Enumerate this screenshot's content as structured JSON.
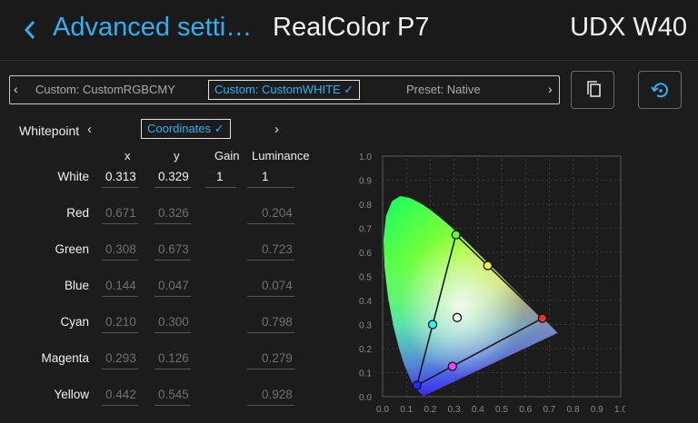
{
  "header": {
    "back_icon": "chevron-left-icon",
    "title_section": "Advanced setti…",
    "title_profile": "RealColor P7",
    "title_device": "UDX W40"
  },
  "profile_selector": {
    "prev_arrow": "‹",
    "next_arrow": "›",
    "left_item": "Custom: CustomRGBCMY",
    "active_item": "Custom: CustomWHITE ✓",
    "right_item": "Preset: Native"
  },
  "toolbar": {
    "copy_icon": "copy-icon",
    "reset_icon": "reset-icon"
  },
  "whitepoint": {
    "label": "Whitepoint",
    "prev_arrow": "‹",
    "next_arrow": "›",
    "active_item": "Coordinates ✓"
  },
  "table": {
    "columns": [
      "x",
      "y",
      "Gain",
      "Luminance"
    ],
    "rows": [
      {
        "name": "White",
        "x": "0.313",
        "y": "0.329",
        "gain": "1",
        "lum": "1"
      },
      {
        "name": "Red",
        "x": "0.671",
        "y": "0.326",
        "gain": "",
        "lum": "0.204"
      },
      {
        "name": "Green",
        "x": "0.308",
        "y": "0.673",
        "gain": "",
        "lum": "0.723"
      },
      {
        "name": "Blue",
        "x": "0.144",
        "y": "0.047",
        "gain": "",
        "lum": "0.074"
      },
      {
        "name": "Cyan",
        "x": "0.210",
        "y": "0.300",
        "gain": "",
        "lum": "0.798"
      },
      {
        "name": "Magenta",
        "x": "0.293",
        "y": "0.126",
        "gain": "",
        "lum": "0.279"
      },
      {
        "name": "Yellow",
        "x": "0.442",
        "y": "0.545",
        "gain": "",
        "lum": "0.928"
      }
    ]
  },
  "colors": {
    "accent": "#2fb0f2",
    "background": "#1c1c1c"
  },
  "chart_data": {
    "type": "scatter",
    "x_ticks": [
      "0.0",
      "0.1",
      "0.2",
      "0.3",
      "0.4",
      "0.5",
      "0.6",
      "0.7",
      "0.8",
      "0.9",
      "1.0"
    ],
    "y_ticks": [
      "0.0",
      "0.1",
      "0.2",
      "0.3",
      "0.4",
      "0.5",
      "0.6",
      "0.7",
      "0.8",
      "0.9",
      "1.0"
    ],
    "xlim": [
      0,
      1
    ],
    "ylim": [
      0,
      1
    ],
    "grid": true,
    "gamut_triangle": [
      [
        0.671,
        0.326
      ],
      [
        0.308,
        0.673
      ],
      [
        0.144,
        0.047
      ]
    ],
    "points": [
      {
        "name": "Red",
        "x": 0.671,
        "y": 0.326,
        "color": "#ff2a2a"
      },
      {
        "name": "Green",
        "x": 0.308,
        "y": 0.673,
        "color": "#5cff3a"
      },
      {
        "name": "Blue",
        "x": 0.144,
        "y": 0.047,
        "color": "#1b2cff"
      },
      {
        "name": "Cyan",
        "x": 0.21,
        "y": 0.3,
        "color": "#30f2ff"
      },
      {
        "name": "Magenta",
        "x": 0.293,
        "y": 0.126,
        "color": "#ff40ff"
      },
      {
        "name": "Yellow",
        "x": 0.442,
        "y": 0.545,
        "color": "#ffff30"
      },
      {
        "name": "White",
        "x": 0.313,
        "y": 0.329,
        "color": "#ffffff"
      }
    ]
  }
}
